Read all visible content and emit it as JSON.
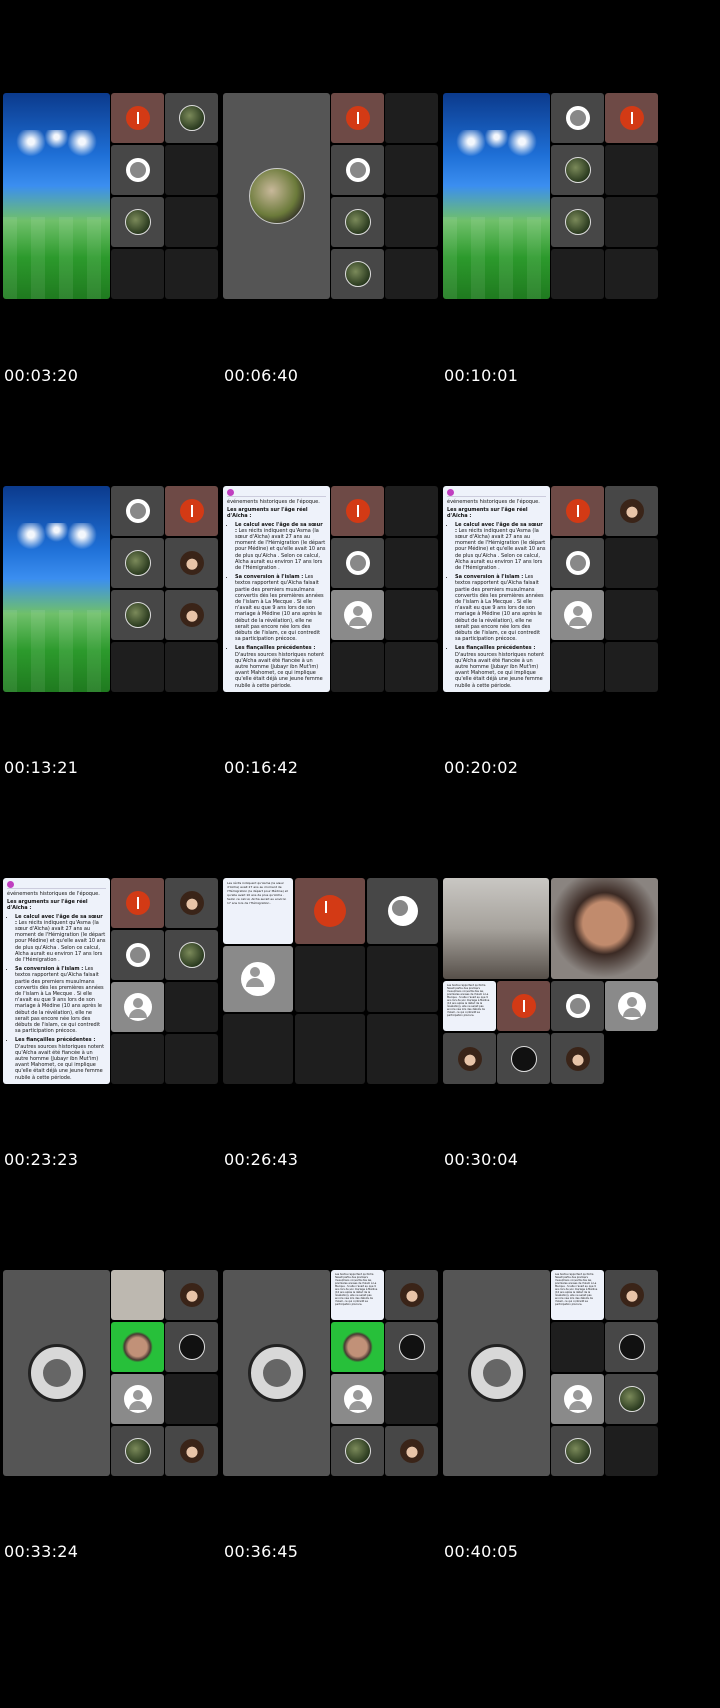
{
  "frames": [
    {
      "timestamp": "00:03:20"
    },
    {
      "timestamp": "00:06:40"
    },
    {
      "timestamp": "00:10:01"
    },
    {
      "timestamp": "00:13:21"
    },
    {
      "timestamp": "00:16:42"
    },
    {
      "timestamp": "00:20:02"
    },
    {
      "timestamp": "00:23:23"
    },
    {
      "timestamp": "00:26:43"
    },
    {
      "timestamp": "00:30:04"
    },
    {
      "timestamp": "00:33:24"
    },
    {
      "timestamp": "00:36:45"
    },
    {
      "timestamp": "00:40:05"
    }
  ],
  "doc": {
    "top_line": "événements historiques de l'époque.",
    "heading": "Les arguments sur l'âge réel d'Aïcha :",
    "items": [
      {
        "title": "Le calcul avec l'âge de sa sœur :",
        "text": "Les récits indiquent qu'Asma (la sœur d'Aïcha) avait 27 ans au moment de l'Hémigration (le départ pour Médine) et qu'elle avait 10 ans de plus qu'Aïcha . Selon ce calcul, Aïcha aurait eu environ 17 ans lors de l'Hémigration ."
      },
      {
        "title": "Sa conversion à l'islam :",
        "text": "Les textos rapportent qu'Aïcha faisait partie des premiers musulmans convertis dès les premières années de l'islam à La Mecque . Si elle n'avait eu que 9 ans lors de son mariage à Médine (10 ans après le début de la révélation), elle ne serait pas encore née lors des débuts de l'islam, ce qui contredit sa participation précoce."
      },
      {
        "title": "Les fiançailles précédentes :",
        "text": "D'autres sources historiques notent qu'Aïcha avait été fiancée à un autre homme (Jubayr ibn Mut'im) avant Mahomet, ce qui implique qu'elle était déjà une jeune femme nubile à cette période."
      }
    ]
  },
  "colors": {
    "background": "#000000",
    "accent_red": "#d33a15",
    "doc_bg": "#eef2fa",
    "tile_dark": "#1e1e1e",
    "tile_gray": "#474747"
  },
  "icons": [
    "mic-muted-avatar",
    "user-placeholder-icon",
    "profile-photo-avatar",
    "document-share-icon",
    "close-icon"
  ]
}
